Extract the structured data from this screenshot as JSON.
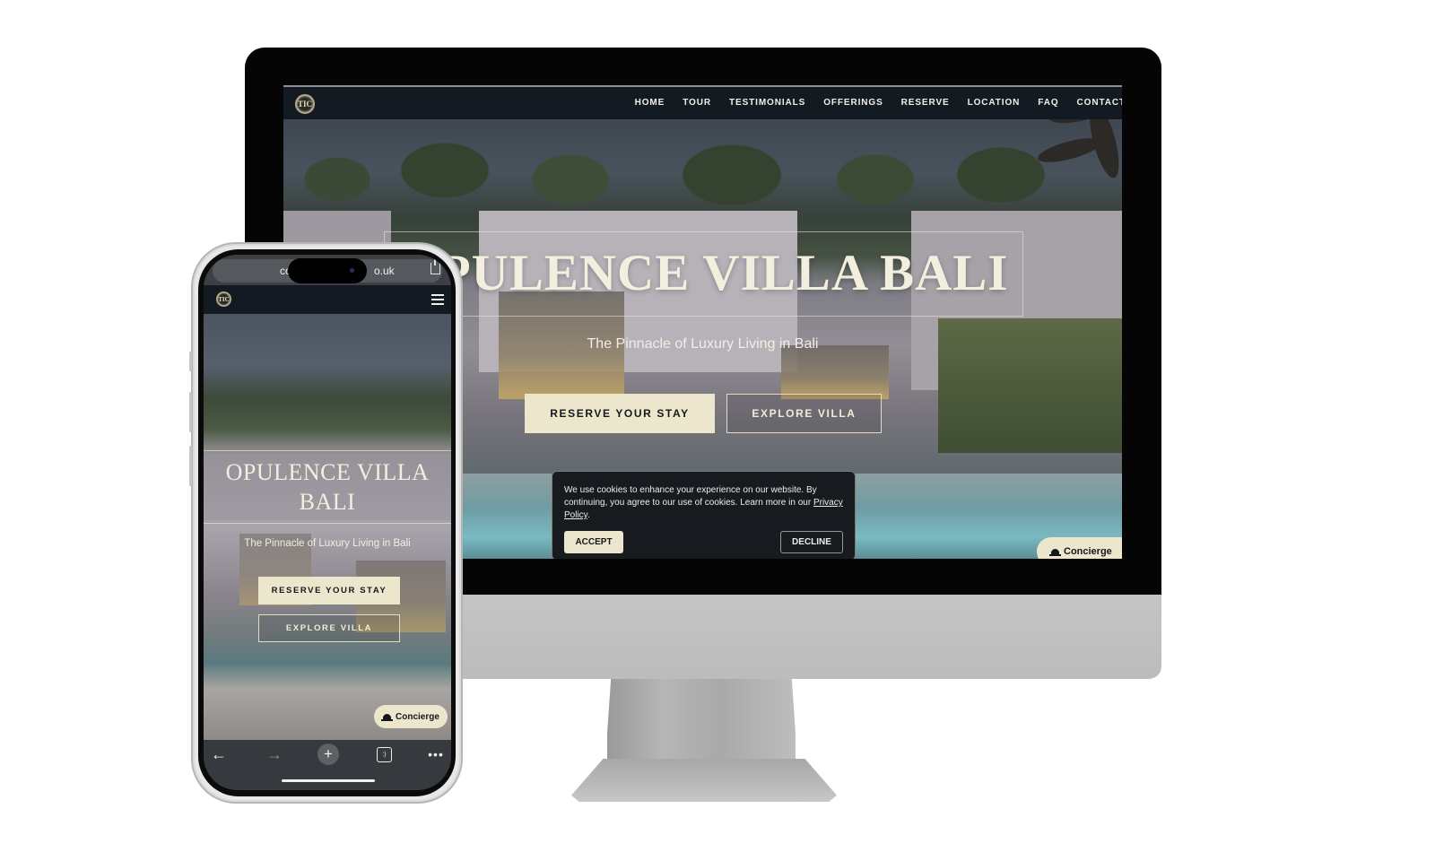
{
  "site": {
    "logo_text": "TIC",
    "nav": [
      "HOME",
      "TOUR",
      "TESTIMONIALS",
      "OFFERINGS",
      "RESERVE",
      "LOCATION",
      "FAQ",
      "CONTACT"
    ],
    "hero_title": "OPULENCE VILLA BALI",
    "hero_title_visible_desktop": "PULENCE VILLA BALI",
    "hero_title_mobile_line1": "OPULENCE VILLA",
    "hero_title_mobile_line2": "BALI",
    "hero_subtitle": "The Pinnacle of Luxury Living in Bali",
    "btn_reserve": "RESERVE YOUR STAY",
    "btn_explore": "EXPLORE VILLA",
    "concierge_label": "Concierge"
  },
  "cookie_banner": {
    "text": "We use cookies to enhance your experience on our website. By continuing, you agree to our use of cookies. Learn more in our",
    "link_label": "Privacy Policy",
    "accept_label": "ACCEPT",
    "decline_label": "DECLINE"
  },
  "phone_browser": {
    "url_left": "coc",
    "url_right": "o.uk",
    "toolbar": {
      "back_icon": "←",
      "forward_icon": "→",
      "new_tab_icon": "+",
      "tabs_icon": ":)",
      "more_icon": "•••"
    }
  },
  "colors": {
    "nav_bg": "#141a21",
    "accent_cream": "#ebe6cc",
    "text_dark": "#14181d",
    "cookie_bg": "#171b20"
  }
}
